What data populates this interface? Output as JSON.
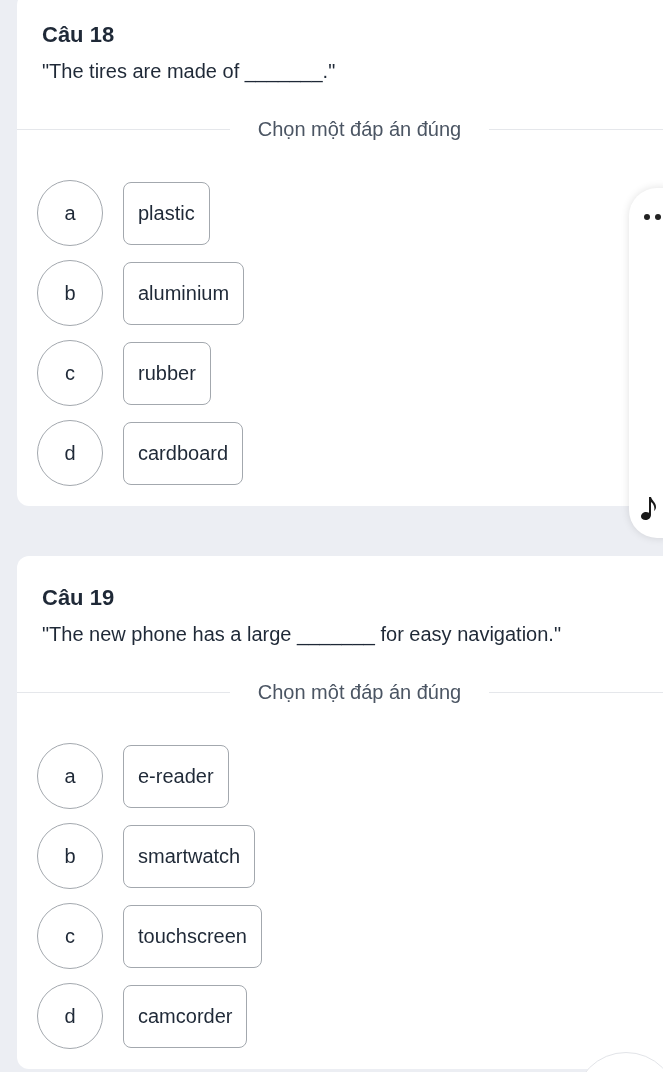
{
  "questions": [
    {
      "title": "Câu 18",
      "prompt": "\"The tires are made of _______.\"",
      "instruction": "Chọn một đáp án đúng",
      "options": [
        {
          "letter": "a",
          "text": "plastic",
          "selected": false
        },
        {
          "letter": "b",
          "text": "aluminium",
          "selected": false
        },
        {
          "letter": "c",
          "text": "rubber",
          "selected": false
        },
        {
          "letter": "d",
          "text": "cardboard",
          "selected": false
        }
      ]
    },
    {
      "title": "Câu 19",
      "prompt": "\"The new phone has a large _______ for easy navigation.\"",
      "instruction": "Chọn một đáp án đúng",
      "options": [
        {
          "letter": "a",
          "text": "e-reader",
          "selected": false
        },
        {
          "letter": "b",
          "text": "smartwatch",
          "selected": false
        },
        {
          "letter": "c",
          "text": "touchscreen",
          "selected": false
        },
        {
          "letter": "d",
          "text": "camcorder",
          "selected": false
        }
      ]
    }
  ]
}
